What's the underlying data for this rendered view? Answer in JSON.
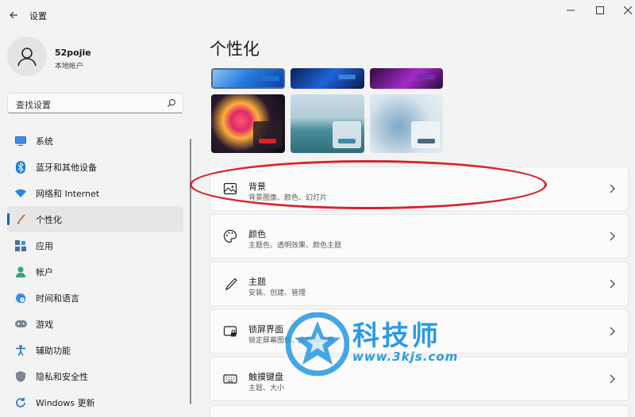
{
  "window": {
    "title": "设置"
  },
  "profile": {
    "name": "52pojie",
    "account_type": "本地帐户"
  },
  "search": {
    "placeholder": "查找设置"
  },
  "nav": {
    "items": [
      {
        "label": "系统",
        "icon": "monitor-icon"
      },
      {
        "label": "蓝牙和其他设备",
        "icon": "bluetooth-icon"
      },
      {
        "label": "网络和 Internet",
        "icon": "wifi-icon"
      },
      {
        "label": "个性化",
        "icon": "brush-icon",
        "active": true
      },
      {
        "label": "应用",
        "icon": "apps-icon"
      },
      {
        "label": "帐户",
        "icon": "person-icon"
      },
      {
        "label": "时间和语言",
        "icon": "globe-clock-icon"
      },
      {
        "label": "游戏",
        "icon": "gamepad-icon"
      },
      {
        "label": "辅助功能",
        "icon": "accessibility-icon"
      },
      {
        "label": "隐私和安全性",
        "icon": "shield-icon"
      },
      {
        "label": "Windows 更新",
        "icon": "update-icon"
      }
    ]
  },
  "main": {
    "title": "个性化",
    "settings": [
      {
        "title": "背景",
        "subtitle": "背景图像、颜色、幻灯片",
        "icon": "image-icon"
      },
      {
        "title": "颜色",
        "subtitle": "主题色、透明效果、颜色主题",
        "icon": "palette-icon"
      },
      {
        "title": "主题",
        "subtitle": "安装、创建、管理",
        "icon": "pen-icon"
      },
      {
        "title": "锁屏界面",
        "subtitle": "锁定屏幕图像、应用和动画",
        "icon": "lock-screen-icon"
      },
      {
        "title": "触摸键盘",
        "subtitle": "主题、大小",
        "icon": "keyboard-icon"
      }
    ]
  },
  "watermark": {
    "title": "科技师",
    "url": "www.3kjs.com"
  },
  "colors": {
    "accent": "#0067c0",
    "highlight": "#d4262c",
    "watermark": "#2a9be3"
  }
}
